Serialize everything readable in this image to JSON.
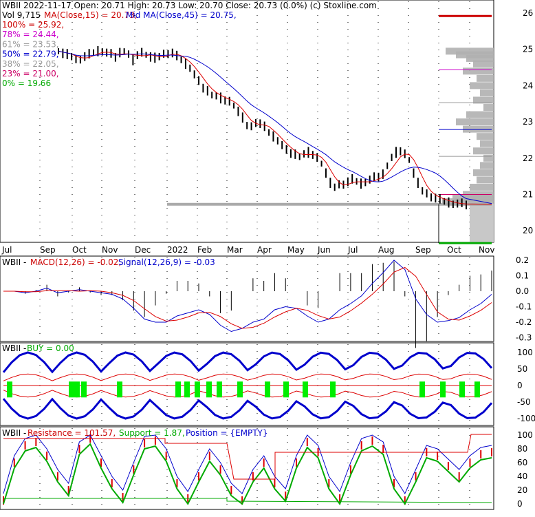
{
  "chart_data": [
    {
      "panel": "price",
      "type": "ohlc",
      "symbol": "WBII",
      "date": "2022-11-17",
      "open": "20.71",
      "high": "20.73",
      "low": "20.70",
      "close": "20.73",
      "change": "(0.0%)",
      "source": "(c) Stoxline.com",
      "header_text": "WBII  2022-11-17 Open: 20.71  High: 20.73  Low: 20.70  Close: 20.73 (0.0%)  (c) Stoxline.com",
      "vol_label": "Vol 9,715",
      "ma15_label": "MA(Close,15) = 20.73,",
      "ma45_label": "Mid MA(Close,45) = 20.75,",
      "fib_levels": [
        {
          "label": "100% = 25.92,",
          "value": 25.92,
          "color": "#cc0000"
        },
        {
          "label": "78% = 24.44,",
          "value": 24.44,
          "color": "#cc00cc"
        },
        {
          "label": "61% = 23.53,",
          "value": 23.53,
          "color": "#999999"
        },
        {
          "label": "50% = 22.79,",
          "value": 22.79,
          "color": "#0000cc"
        },
        {
          "label": "38% = 22.05,",
          "value": 22.05,
          "color": "#999999"
        },
        {
          "label": "23% = 21.00,",
          "value": 21.0,
          "color": "#cc0066"
        },
        {
          "label": "0% = 19.66",
          "value": 19.66,
          "color": "#00aa00"
        }
      ],
      "y_ticks": [
        "26",
        "25",
        "24",
        "23",
        "22",
        "21",
        "20"
      ],
      "ylim": [
        19.6,
        26.3
      ],
      "x_labels": [
        "Jul",
        "Sep",
        "Oct",
        "Nov",
        "Dec",
        "2022",
        "Feb",
        "Mar",
        "Apr",
        "May",
        "Jun",
        "Jul",
        "Aug",
        "Sep",
        "Oct",
        "Nov"
      ],
      "close_series": [
        24.95,
        24.9,
        24.85,
        24.8,
        24.7,
        24.75,
        24.8,
        24.85,
        24.9,
        24.95,
        24.95,
        24.9,
        24.85,
        24.8,
        24.9,
        24.95,
        24.85,
        24.7,
        24.85,
        24.9,
        24.85,
        24.8,
        24.75,
        24.8,
        24.85,
        24.9,
        24.9,
        24.8,
        24.7,
        24.6,
        24.5,
        24.3,
        24.1,
        23.95,
        23.85,
        23.75,
        23.7,
        23.65,
        23.6,
        23.55,
        23.45,
        23.3,
        23.1,
        22.9,
        22.85,
        23.0,
        22.95,
        22.85,
        22.7,
        22.6,
        22.5,
        22.35,
        22.2,
        22.15,
        22.1,
        22.05,
        22.1,
        22.15,
        22.1,
        22.0,
        21.85,
        21.6,
        21.3,
        21.2,
        21.25,
        21.3,
        21.35,
        21.4,
        21.35,
        21.3,
        21.35,
        21.4,
        21.45,
        21.5,
        21.55,
        21.8,
        22.0,
        22.15,
        22.2,
        22.1,
        21.95,
        21.6,
        21.3,
        21.1,
        21.0,
        20.95,
        20.9,
        20.85,
        20.8,
        20.78,
        20.75,
        20.74,
        20.73,
        20.73
      ]
    },
    {
      "panel": "macd",
      "type": "line",
      "label_title": "WBII - ",
      "label_macd": "MACD(12,26) = -0.02,",
      "label_signal": "Signal(12,26,9) = -0.03",
      "y_ticks": [
        "0.2",
        "0.1",
        "0.0",
        "-0.1",
        "-0.2",
        "-0.3"
      ],
      "ylim": [
        -0.32,
        0.25
      ]
    },
    {
      "panel": "buy",
      "type": "line",
      "label_title": "WBII - ",
      "label_buy": "BUY = 0.00",
      "y_ticks": [
        "100",
        "50",
        "0",
        "-50",
        "-100"
      ],
      "ylim": [
        -120,
        120
      ]
    },
    {
      "panel": "stochastic",
      "type": "line",
      "label_title": "WBII - ",
      "label_resistance": "Resistance = 101.57,",
      "label_support": "Support = 1.87,",
      "label_position": "Position = {EMPTY}",
      "y_ticks": [
        "100",
        "80",
        "60",
        "40",
        "20",
        "0"
      ],
      "ylim": [
        -2,
        106
      ]
    }
  ],
  "colors": {
    "ma15": "#dd0000",
    "ma45": "#0000cc",
    "price_bar": "#000000",
    "macd_line": "#0000cc",
    "signal_line": "#dd0000",
    "histogram": "#000000",
    "band": "#0000cc",
    "buy_marker": "#00ee00",
    "volume_profile": "#b0b0b0",
    "stoch_k": "#dd0000",
    "stoch_d": "#00aa00",
    "support": "#00aa00",
    "resistance": "#dd0000"
  }
}
